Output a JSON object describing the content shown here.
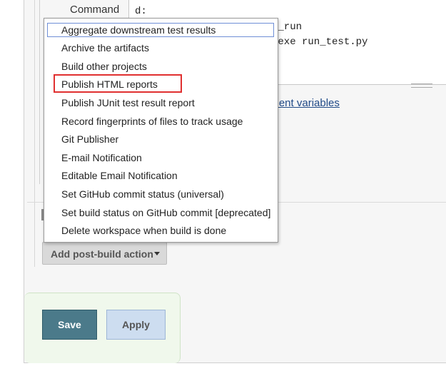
{
  "command": {
    "label": "Command",
    "lines": [
      "d:",
      "t_run",
      ".exe run_test.py"
    ]
  },
  "env_link": "nment variables",
  "menu": {
    "items": [
      "Aggregate downstream test results",
      "Archive the artifacts",
      "Build other projects",
      "Publish HTML reports",
      "Publish JUnit test result report",
      "Record fingerprints of files to track usage",
      "Git Publisher",
      "E-mail Notification",
      "Editable Email Notification",
      "Set GitHub commit status (universal)",
      "Set build status on GitHub commit [deprecated]",
      "Delete workspace when build is done"
    ],
    "focused_item": "Aggregate downstream test results",
    "highlighted_item": "Publish HTML reports"
  },
  "add_action": {
    "label": "Add post-build action"
  },
  "buttons": {
    "save": "Save",
    "apply": "Apply"
  },
  "colors": {
    "save_bg": "#4b7a8a",
    "apply_bg": "#cdddf0",
    "highlight_border": "#e03030",
    "link": "#204a87"
  }
}
